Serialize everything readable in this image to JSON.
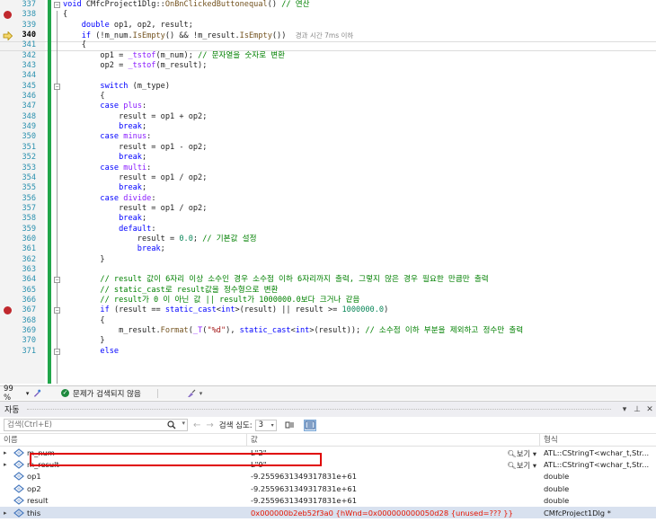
{
  "editor": {
    "lines": [
      {
        "n": "337",
        "bp": false,
        "ip": false,
        "fold": "minus",
        "html": "<span class=\"kw\">void</span> CMfcProject1Dlg::<span class=\"fn\">OnBnClickedButtonequal</span>() <span class=\"cm\">// 연산</span>"
      },
      {
        "n": "338",
        "bp": true,
        "ip": false,
        "fold": "",
        "html": "{"
      },
      {
        "n": "339",
        "bp": false,
        "ip": false,
        "fold": "",
        "html": "    <span class=\"kw\">double</span> op1, op2, result;"
      },
      {
        "n": "340",
        "bp": false,
        "ip": true,
        "fold": "",
        "html": "    <span class=\"kw\">if</span> (!m_num.<span class=\"fn\">IsEmpty</span>() && !m_result.<span class=\"fn\">IsEmpty</span>())  <span class=\"hint\">경과 시간 7ms 이하</span>"
      },
      {
        "n": "341",
        "bp": false,
        "ip": false,
        "fold": "",
        "html": "    {"
      },
      {
        "n": "342",
        "bp": false,
        "ip": false,
        "fold": "",
        "html": "        op1 = <span class=\"mc\">_tstof</span>(m_num); <span class=\"cm\">// 문자열을 숫자로 변환</span>"
      },
      {
        "n": "343",
        "bp": false,
        "ip": false,
        "fold": "",
        "html": "        op2 = <span class=\"mc\">_tstof</span>(m_result);"
      },
      {
        "n": "344",
        "bp": false,
        "ip": false,
        "fold": "",
        "html": ""
      },
      {
        "n": "345",
        "bp": false,
        "ip": false,
        "fold": "minus",
        "html": "        <span class=\"kw\">switch</span> (m_type)"
      },
      {
        "n": "346",
        "bp": false,
        "ip": false,
        "fold": "",
        "html": "        {"
      },
      {
        "n": "347",
        "bp": false,
        "ip": false,
        "fold": "",
        "html": "        <span class=\"kw\">case</span> <span class=\"mc\">plus</span>:"
      },
      {
        "n": "348",
        "bp": false,
        "ip": false,
        "fold": "",
        "html": "            result = op1 + op2;"
      },
      {
        "n": "349",
        "bp": false,
        "ip": false,
        "fold": "",
        "html": "            <span class=\"kw\">break</span>;"
      },
      {
        "n": "350",
        "bp": false,
        "ip": false,
        "fold": "",
        "html": "        <span class=\"kw\">case</span> <span class=\"mc\">minus</span>:"
      },
      {
        "n": "351",
        "bp": false,
        "ip": false,
        "fold": "",
        "html": "            result = op1 - op2;"
      },
      {
        "n": "352",
        "bp": false,
        "ip": false,
        "fold": "",
        "html": "            <span class=\"kw\">break</span>;"
      },
      {
        "n": "353",
        "bp": false,
        "ip": false,
        "fold": "",
        "html": "        <span class=\"kw\">case</span> <span class=\"mc\">multi</span>:"
      },
      {
        "n": "354",
        "bp": false,
        "ip": false,
        "fold": "",
        "html": "            result = op1 / op2;"
      },
      {
        "n": "355",
        "bp": false,
        "ip": false,
        "fold": "",
        "html": "            <span class=\"kw\">break</span>;"
      },
      {
        "n": "356",
        "bp": false,
        "ip": false,
        "fold": "",
        "html": "        <span class=\"kw\">case</span> <span class=\"mc\">divide</span>:"
      },
      {
        "n": "357",
        "bp": false,
        "ip": false,
        "fold": "",
        "html": "            result = op1 / op2;"
      },
      {
        "n": "358",
        "bp": false,
        "ip": false,
        "fold": "",
        "html": "            <span class=\"kw\">break</span>;"
      },
      {
        "n": "359",
        "bp": false,
        "ip": false,
        "fold": "",
        "html": "            <span class=\"kw\">default</span>:"
      },
      {
        "n": "360",
        "bp": false,
        "ip": false,
        "fold": "",
        "html": "                result = <span class=\"nm\">0.0</span>; <span class=\"cm\">// 기본값 설정</span>"
      },
      {
        "n": "361",
        "bp": false,
        "ip": false,
        "fold": "",
        "html": "                <span class=\"kw\">break</span>;"
      },
      {
        "n": "362",
        "bp": false,
        "ip": false,
        "fold": "",
        "html": "        }"
      },
      {
        "n": "363",
        "bp": false,
        "ip": false,
        "fold": "",
        "html": ""
      },
      {
        "n": "364",
        "bp": false,
        "ip": false,
        "fold": "minus",
        "html": "        <span class=\"cm\">// result 값이 6자리 이상 소수인 경우 소수점 이하 6자리까지 출력, 그렇지 않은 경우 필요한 만큼만 출력</span>"
      },
      {
        "n": "365",
        "bp": false,
        "ip": false,
        "fold": "",
        "html": "        <span class=\"cm\">// static_cast로 result값을 정수형으로 변환</span>"
      },
      {
        "n": "366",
        "bp": false,
        "ip": false,
        "fold": "",
        "html": "        <span class=\"cm\">// result가 0 이 아닌 값 || result가 1000000.0보다 크거나 같음</span>"
      },
      {
        "n": "367",
        "bp": true,
        "ip": false,
        "fold": "minus",
        "html": "        <span class=\"kw\">if</span> (result == <span class=\"kw\">static_cast</span><<span class=\"kw\">int</span>>(result) || result >= <span class=\"nm\">1000000.0</span>)"
      },
      {
        "n": "368",
        "bp": false,
        "ip": false,
        "fold": "",
        "html": "        {"
      },
      {
        "n": "369",
        "bp": false,
        "ip": false,
        "fold": "",
        "html": "            m_result.<span class=\"fn\">Format</span>(<span class=\"mc\">_T</span>(<span class=\"str\">\"%d\"</span>), <span class=\"kw\">static_cast</span><<span class=\"kw\">int</span>>(result)); <span class=\"cm\">// 소수점 이하 부분을 제외하고 정수만 출력</span>"
      },
      {
        "n": "370",
        "bp": false,
        "ip": false,
        "fold": "",
        "html": "        }"
      },
      {
        "n": "371",
        "bp": false,
        "ip": false,
        "fold": "minus",
        "html": "        <span class=\"kw\">else</span>"
      }
    ]
  },
  "status": {
    "zoom": "99 %",
    "issues": "문제가 검색되지 않음"
  },
  "autos": {
    "title": "자동",
    "pin_label": "▾",
    "pin2_label": "⊥",
    "close_label": "✕",
    "search_placeholder": "검색(Ctrl+E)",
    "depth_label": "검색 심도:",
    "depth_value": "3",
    "columns": {
      "name": "이름",
      "value": "값",
      "type": "형식"
    },
    "view_label": "보기",
    "rows": [
      {
        "expandable": true,
        "name": "m_num",
        "value": "L\"2\"",
        "type": "ATL::CStringT<wchar_t,Str...",
        "view": true,
        "red": false,
        "sel": false
      },
      {
        "expandable": true,
        "name": "m_result",
        "value": "L\"9\"",
        "type": "ATL::CStringT<wchar_t,Str...",
        "view": true,
        "red": false,
        "sel": false
      },
      {
        "expandable": false,
        "name": "op1",
        "value": "-9.2559631349317831e+61",
        "type": "double",
        "view": false,
        "red": false,
        "sel": false
      },
      {
        "expandable": false,
        "name": "op2",
        "value": "-9.2559631349317831e+61",
        "type": "double",
        "view": false,
        "red": false,
        "sel": false
      },
      {
        "expandable": false,
        "name": "result",
        "value": "-9.2559631349317831e+61",
        "type": "double",
        "view": false,
        "red": false,
        "sel": false
      },
      {
        "expandable": true,
        "name": "this",
        "value": "0x000000b2eb52f3a0 {hWnd=0x000000000050d28 {unused=??? }}",
        "type": "CMfcProject1Dlg *",
        "view": false,
        "red": true,
        "sel": true
      }
    ]
  }
}
